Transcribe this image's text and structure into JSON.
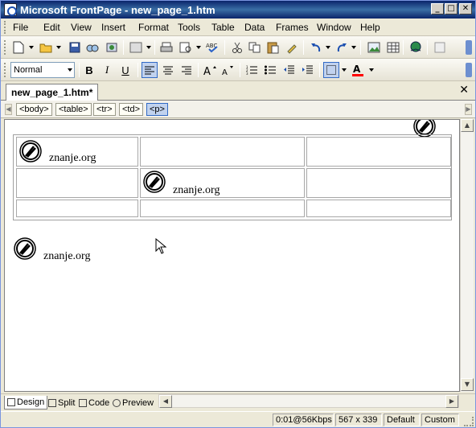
{
  "window": {
    "title": "Microsoft FrontPage - new_page_1.htm"
  },
  "title_buttons": {
    "minimize": "_",
    "restore": "□",
    "close": "✕"
  },
  "menu": [
    "File",
    "Edit",
    "View",
    "Insert",
    "Format",
    "Tools",
    "Table",
    "Data",
    "Frames",
    "Window",
    "Help"
  ],
  "formatting": {
    "style": "Normal",
    "bold": "B",
    "italic": "I",
    "underline": "U"
  },
  "document": {
    "tab_label": "new_page_1.htm*",
    "close": "✕"
  },
  "tag_selector": [
    "<body>",
    "<table>",
    "<tr>",
    "<td>",
    "<p>"
  ],
  "content": {
    "logo_text": "znanje.org",
    "cell_1": "znanje.org",
    "cell_5": "znanje.org",
    "below_table": "znanje.org"
  },
  "view_tabs": [
    "Design",
    "Split",
    "Code",
    "Preview"
  ],
  "status": {
    "download": "0:01@56Kbps",
    "size": "567 x 339",
    "mode": "Default",
    "schema": "Custom"
  },
  "colors": {
    "title_bar": "#0a246a",
    "active_tag": "#c1d2ee",
    "font_color_swatch": "#ff0000"
  }
}
